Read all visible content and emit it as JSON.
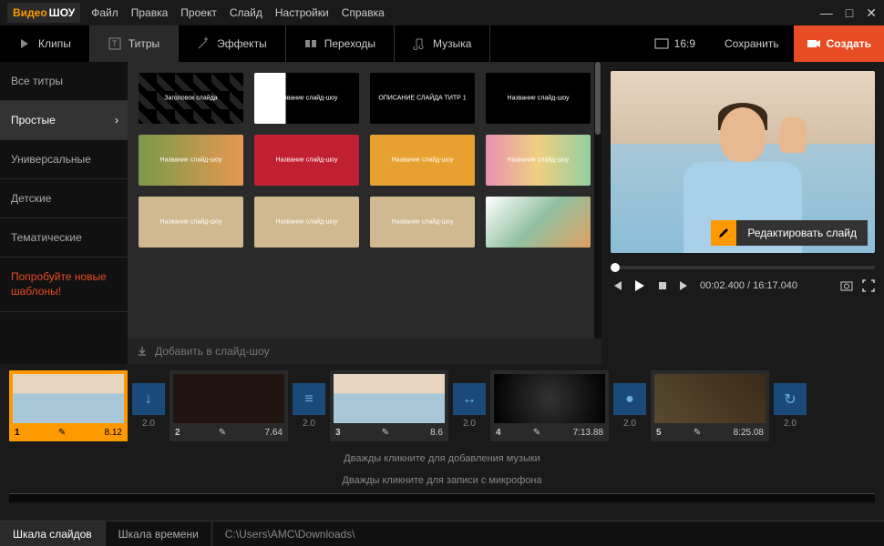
{
  "app": {
    "logo1": "Видео",
    "logo2": "ШОУ"
  },
  "menu": [
    "Файл",
    "Правка",
    "Проект",
    "Слайд",
    "Настройки",
    "Справка"
  ],
  "tabs": {
    "clips": "Клипы",
    "titles": "Титры",
    "effects": "Эффекты",
    "transitions": "Переходы",
    "music": "Музыка"
  },
  "toolbar": {
    "aspect": "16:9",
    "save": "Сохранить",
    "create": "Создать"
  },
  "sidebar": [
    "Все титры",
    "Простые",
    "Универсальные",
    "Детские",
    "Тематические",
    "Попробуйте новые шаблоны!"
  ],
  "active_side": 1,
  "thumbs": [
    {
      "t": "Заголовок слайда",
      "c": "th-dark"
    },
    {
      "t": "Название слайд-шоу",
      "c": "th-bw"
    },
    {
      "t": "ОПИСАНИЕ СЛАЙДА  ТИТР 1",
      "c": ""
    },
    {
      "t": "Название слайд-шоу",
      "c": "th-stars"
    },
    {
      "t": "Название слайд-шоу",
      "c": "th-flowers"
    },
    {
      "t": "Название слайд-шоу",
      "c": "th-berry"
    },
    {
      "t": "Название слайд-шоу",
      "c": "th-daisy"
    },
    {
      "t": "Название слайд-шоу",
      "c": "th-macaron"
    },
    {
      "t": "Название слайд-шоу",
      "c": "th-paper"
    },
    {
      "t": "Название слайд-шоу",
      "c": "th-paper"
    },
    {
      "t": "Название слайд-шоу",
      "c": "th-paper"
    },
    {
      "t": "",
      "c": "th-wc"
    }
  ],
  "addbtn": "Добавить в слайд-шоу",
  "preview": {
    "edit": "Редактировать слайд",
    "time_cur": "00:02.400",
    "time_total": "16:17.040"
  },
  "clips": [
    {
      "n": "1",
      "d": "8.12",
      "c": "clip-p1",
      "sel": true
    },
    {
      "n": "2",
      "d": "7.64",
      "c": "clip-p2"
    },
    {
      "n": "3",
      "d": "8.6",
      "c": "clip-p1"
    },
    {
      "n": "4",
      "d": "7:13.88",
      "c": "clip-p3"
    },
    {
      "n": "5",
      "d": "8:25.08",
      "c": "clip-p4"
    }
  ],
  "trans_dur": "2.0",
  "hints": {
    "music": "Дважды кликните для добавления музыки",
    "mic": "Дважды кликните для записи с микрофона"
  },
  "status": {
    "tab1": "Шкала слайдов",
    "tab2": "Шкала времени",
    "path": "C:\\Users\\AMC\\Downloads\\"
  }
}
